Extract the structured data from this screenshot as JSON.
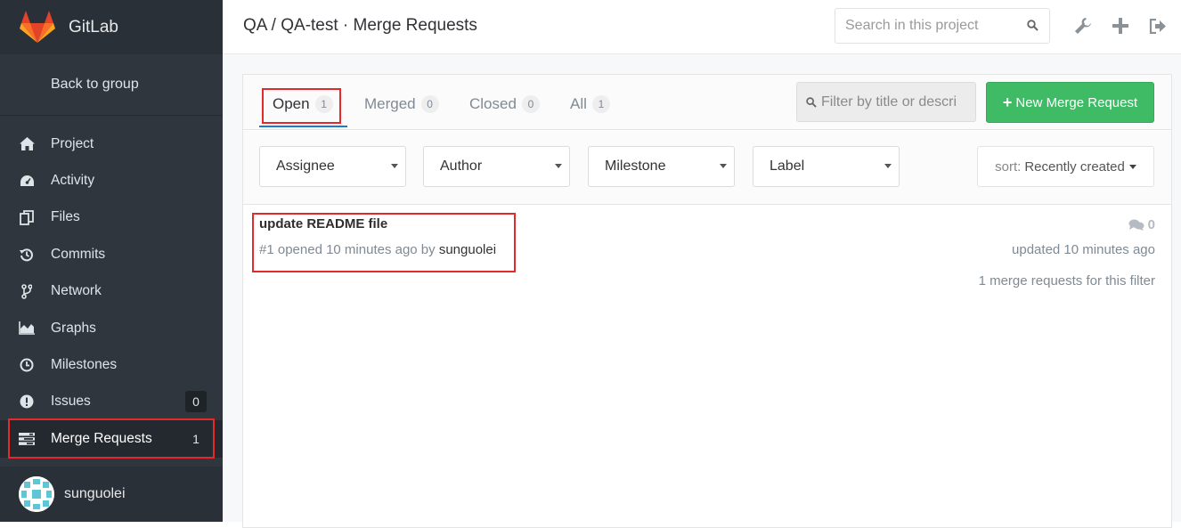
{
  "brand": {
    "name": "GitLab"
  },
  "sidebar": {
    "back_label": "Back to group",
    "items": [
      {
        "label": "Project",
        "icon": "home-icon"
      },
      {
        "label": "Activity",
        "icon": "dashboard-icon"
      },
      {
        "label": "Files",
        "icon": "files-icon"
      },
      {
        "label": "Commits",
        "icon": "history-icon"
      },
      {
        "label": "Network",
        "icon": "code-fork-icon"
      },
      {
        "label": "Graphs",
        "icon": "area-chart-icon"
      },
      {
        "label": "Milestones",
        "icon": "clock-icon"
      },
      {
        "label": "Issues",
        "icon": "exclamation-circle-icon",
        "count": "0"
      },
      {
        "label": "Merge Requests",
        "icon": "tasks-icon",
        "count": "1"
      }
    ]
  },
  "user": {
    "name": "sunguolei"
  },
  "header": {
    "title": "QA / QA-test · Merge Requests",
    "search_placeholder": "Search in this project"
  },
  "tabs": [
    {
      "label": "Open",
      "count": "1"
    },
    {
      "label": "Merged",
      "count": "0"
    },
    {
      "label": "Closed",
      "count": "0"
    },
    {
      "label": "All",
      "count": "1"
    }
  ],
  "filter": {
    "placeholder": "Filter by title or descri"
  },
  "new_mr": {
    "label": "New Merge Request"
  },
  "dropdowns": [
    "Assignee",
    "Author",
    "Milestone",
    "Label"
  ],
  "sort": {
    "label": "sort:",
    "value": "Recently created"
  },
  "merge_request": {
    "title": "update README file",
    "meta": "#1 opened 10 minutes ago by",
    "author": "sunguolei",
    "notes_count": "0",
    "updated": "updated 10 minutes ago"
  },
  "result_count": "1 merge requests for this filter",
  "colors": {
    "sidebar_bg": "#2f363d",
    "accent_green": "#3fba65",
    "highlight_red": "#e32929",
    "tab_active_blue": "#1f78d1"
  }
}
